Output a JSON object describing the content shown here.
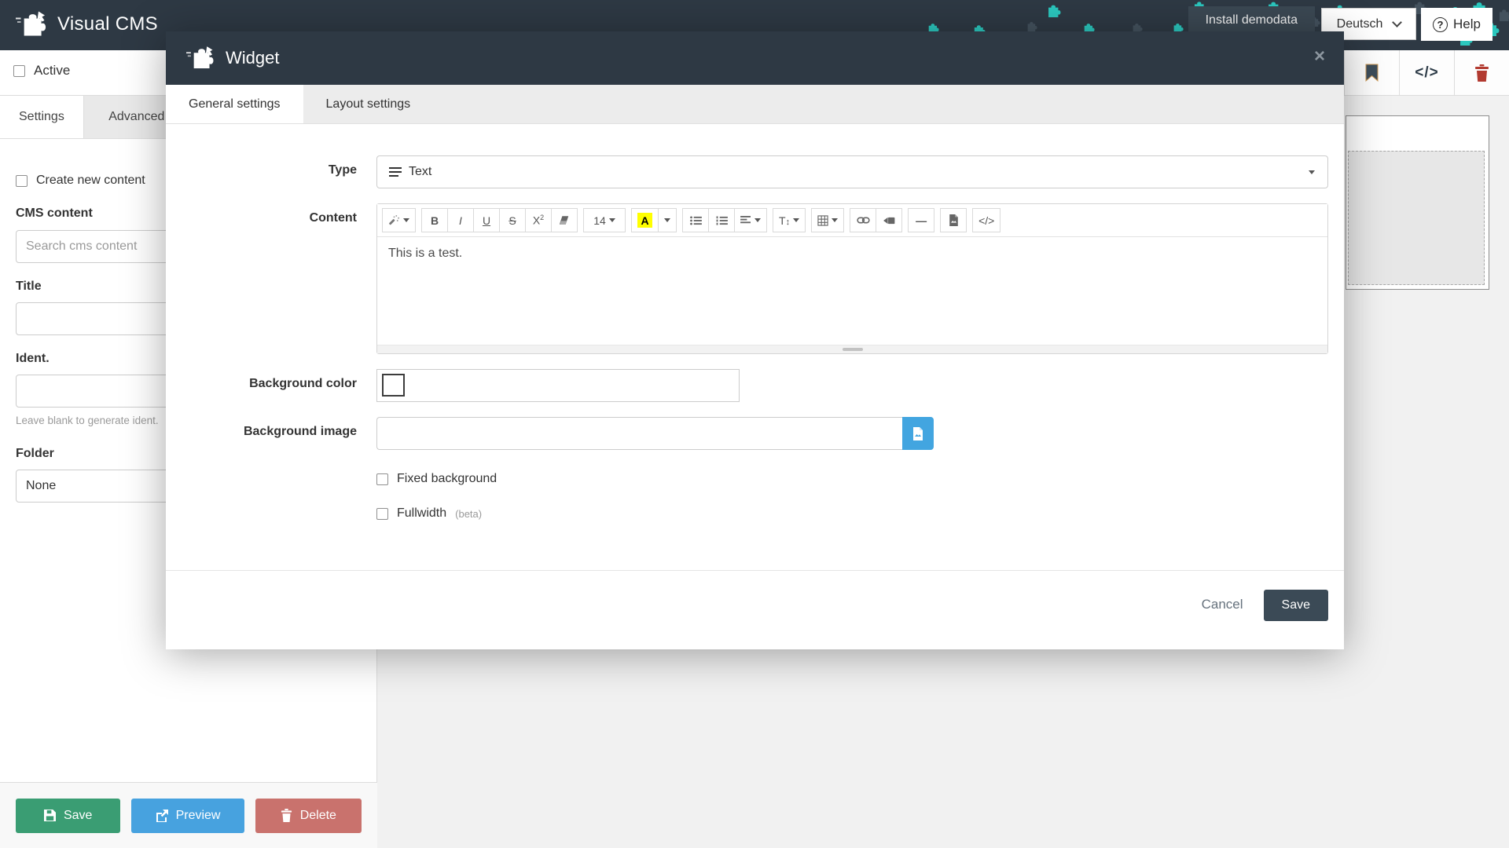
{
  "navbar": {
    "brand": "Visual CMS",
    "install_demodata": "Install demodata",
    "language": "Deutsch",
    "help": "Help"
  },
  "page": {
    "active_label": "Active",
    "tabs": {
      "settings": "Settings",
      "advanced": "Advanced"
    },
    "create_new_content": "Create new content",
    "cms_content_label": "CMS content",
    "cms_search_placeholder": "Search cms content",
    "title_label": "Title",
    "ident_label": "Ident.",
    "ident_help": "Leave blank to generate ident.",
    "folder_label": "Folder",
    "folder_value": "None",
    "save_button": "Save",
    "preview_button": "Preview",
    "delete_button": "Delete"
  },
  "modal": {
    "title": "Widget",
    "tabs": {
      "general": "General settings",
      "layout": "Layout settings"
    },
    "type_label": "Type",
    "type_value": "Text",
    "content_label": "Content",
    "content_text": "This is a test.",
    "toolbar": {
      "bold": "B",
      "italic": "I",
      "underline": "U",
      "strike": "S",
      "sup_base": "X",
      "sup_exp": "2",
      "font_size": "14",
      "color_letter": "A",
      "line_height": "T"
    },
    "background_color_label": "Background color",
    "background_image_label": "Background image",
    "background_image_value": "",
    "fixed_background_label": "Fixed background",
    "fullwidth_label": "Fullwidth",
    "fullwidth_beta": "(beta)",
    "cancel_button": "Cancel",
    "save_button": "Save"
  },
  "icons": {
    "close": "×",
    "code": "</>",
    "hr": "—",
    "help_qmark": "?",
    "updown": "↕"
  },
  "colors": {
    "navbar_dark": "#2e3944",
    "accent_teal": "#2bc7be",
    "save_green": "#3a9d73",
    "preview_blue": "#47a2df",
    "delete_red": "#c9726d",
    "browse_blue": "#42a5e0",
    "trash_red": "#b23a30",
    "highlight_yellow": "#ffff00"
  }
}
